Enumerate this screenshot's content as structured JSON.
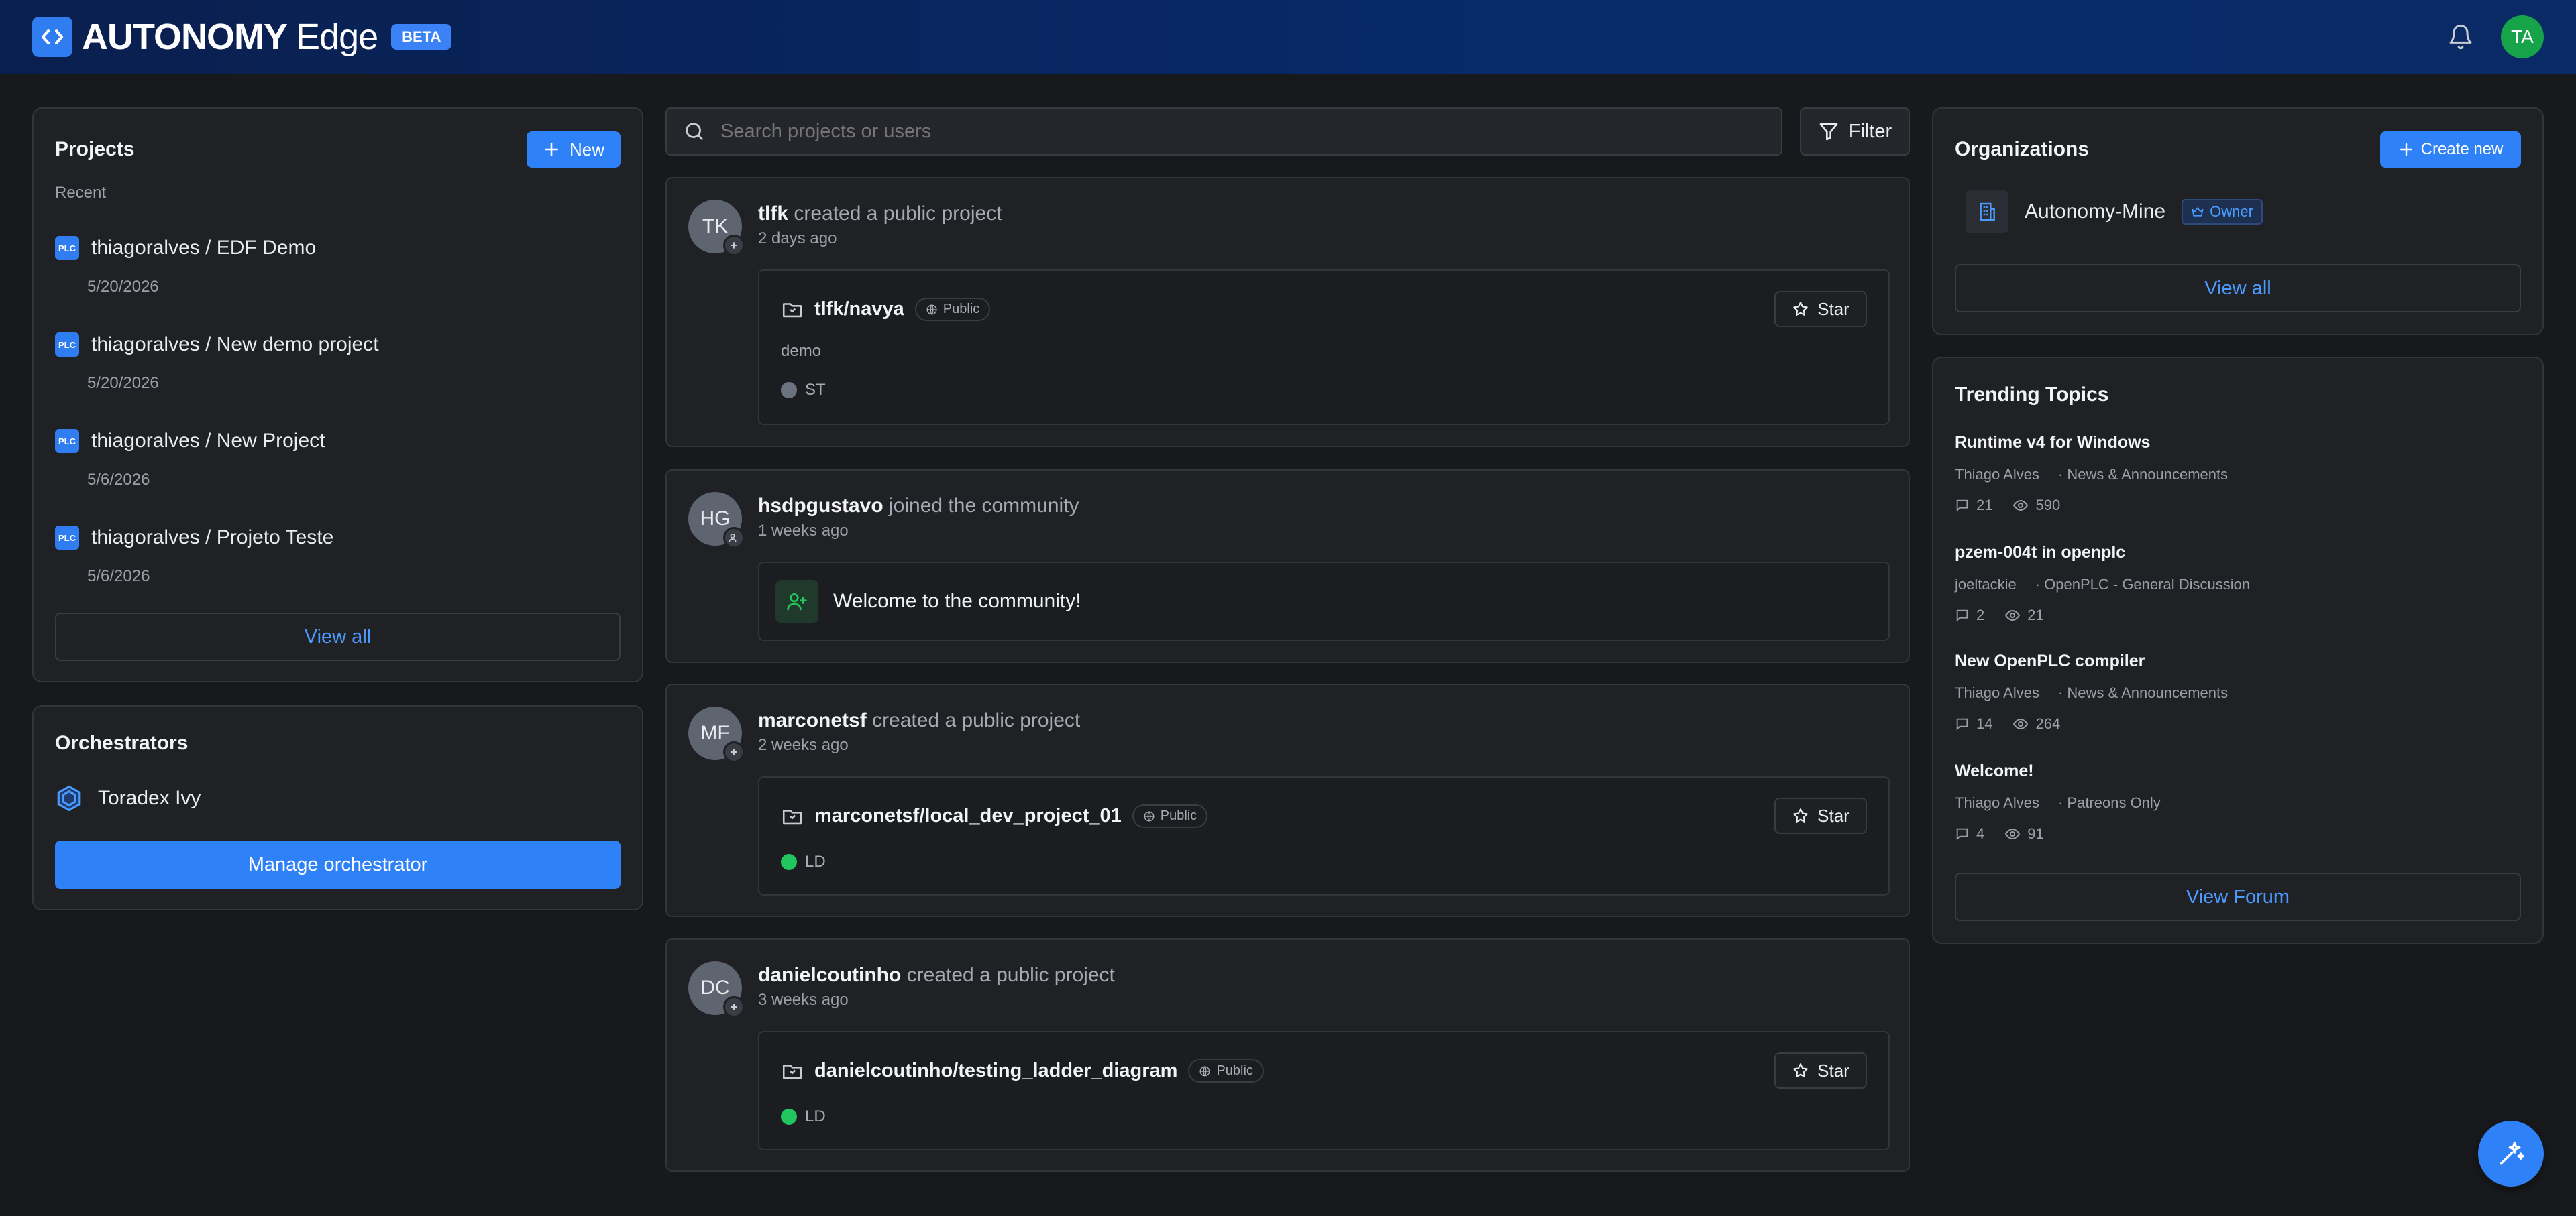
{
  "header": {
    "brand_main": "AUTONOMY",
    "brand_sub": "Edge",
    "badge": "BETA",
    "avatar": "TA",
    "icons": [
      "code-icon",
      "bell-icon"
    ]
  },
  "projects": {
    "title": "Projects",
    "new_label": "New",
    "recent_label": "Recent",
    "items": [
      {
        "icon": "PLC",
        "name": "thiagoralves / EDF Demo",
        "date": "5/20/2026"
      },
      {
        "icon": "PLC",
        "name": "thiagoralves / New demo project",
        "date": "5/20/2026"
      },
      {
        "icon": "PLC",
        "name": "thiagoralves / New Project",
        "date": "5/6/2026"
      },
      {
        "icon": "PLC",
        "name": "thiagoralves / Projeto Teste",
        "date": "5/6/2026"
      }
    ],
    "view_all": "View all"
  },
  "orchestrators": {
    "title": "Orchestrators",
    "item": "Toradex Ivy",
    "manage_label": "Manage orchestrator"
  },
  "search": {
    "placeholder": "Search projects or users",
    "filter_label": "Filter"
  },
  "feed": [
    {
      "initials": "TK",
      "user": "tlfk",
      "action": "created a public project",
      "time": "2 days ago",
      "repo": "tlfk/navya",
      "visibility": "Public",
      "description": "demo",
      "lang": "ST",
      "lang_color": "#6b7280",
      "star": "Star"
    },
    {
      "initials": "HG",
      "user": "hsdpgustavo",
      "action": "joined the community",
      "time": "1 weeks ago",
      "welcome": "Welcome to the community!"
    },
    {
      "initials": "MF",
      "user": "marconetsf",
      "action": "created a public project",
      "time": "2 weeks ago",
      "repo": "marconetsf/local_dev_project_01",
      "visibility": "Public",
      "lang": "LD",
      "lang_color": "#22c55e",
      "star": "Star"
    },
    {
      "initials": "DC",
      "user": "danielcoutinho",
      "action": "created a public project",
      "time": "3 weeks ago",
      "repo": "danielcoutinho/testing_ladder_diagram",
      "visibility": "Public",
      "lang": "LD",
      "lang_color": "#22c55e",
      "star": "Star"
    }
  ],
  "organizations": {
    "title": "Organizations",
    "create_label": "Create new",
    "org_name": "Autonomy-Mine",
    "role": "Owner",
    "view_all": "View all"
  },
  "trending": {
    "title": "Trending Topics",
    "topics": [
      {
        "title": "Runtime v4 for Windows",
        "author": "Thiago Alves",
        "category": "· News & Announcements",
        "comments": "21",
        "views": "590"
      },
      {
        "title": "pzem-004t in openplc",
        "author": "joeltackie",
        "category": "· OpenPLC - General Discussion",
        "comments": "2",
        "views": "21"
      },
      {
        "title": "New OpenPLC compiler",
        "author": "Thiago Alves",
        "category": "· News & Announcements",
        "comments": "14",
        "views": "264"
      },
      {
        "title": "Welcome!",
        "author": "Thiago Alves",
        "category": "· Patreons Only",
        "comments": "4",
        "views": "91"
      }
    ],
    "view_forum": "View Forum"
  },
  "colors": {
    "accent": "#2f81f7",
    "header_bg": "#0a1f4e",
    "bg": "#18191c",
    "card": "#202125",
    "online": "#22c55e"
  }
}
